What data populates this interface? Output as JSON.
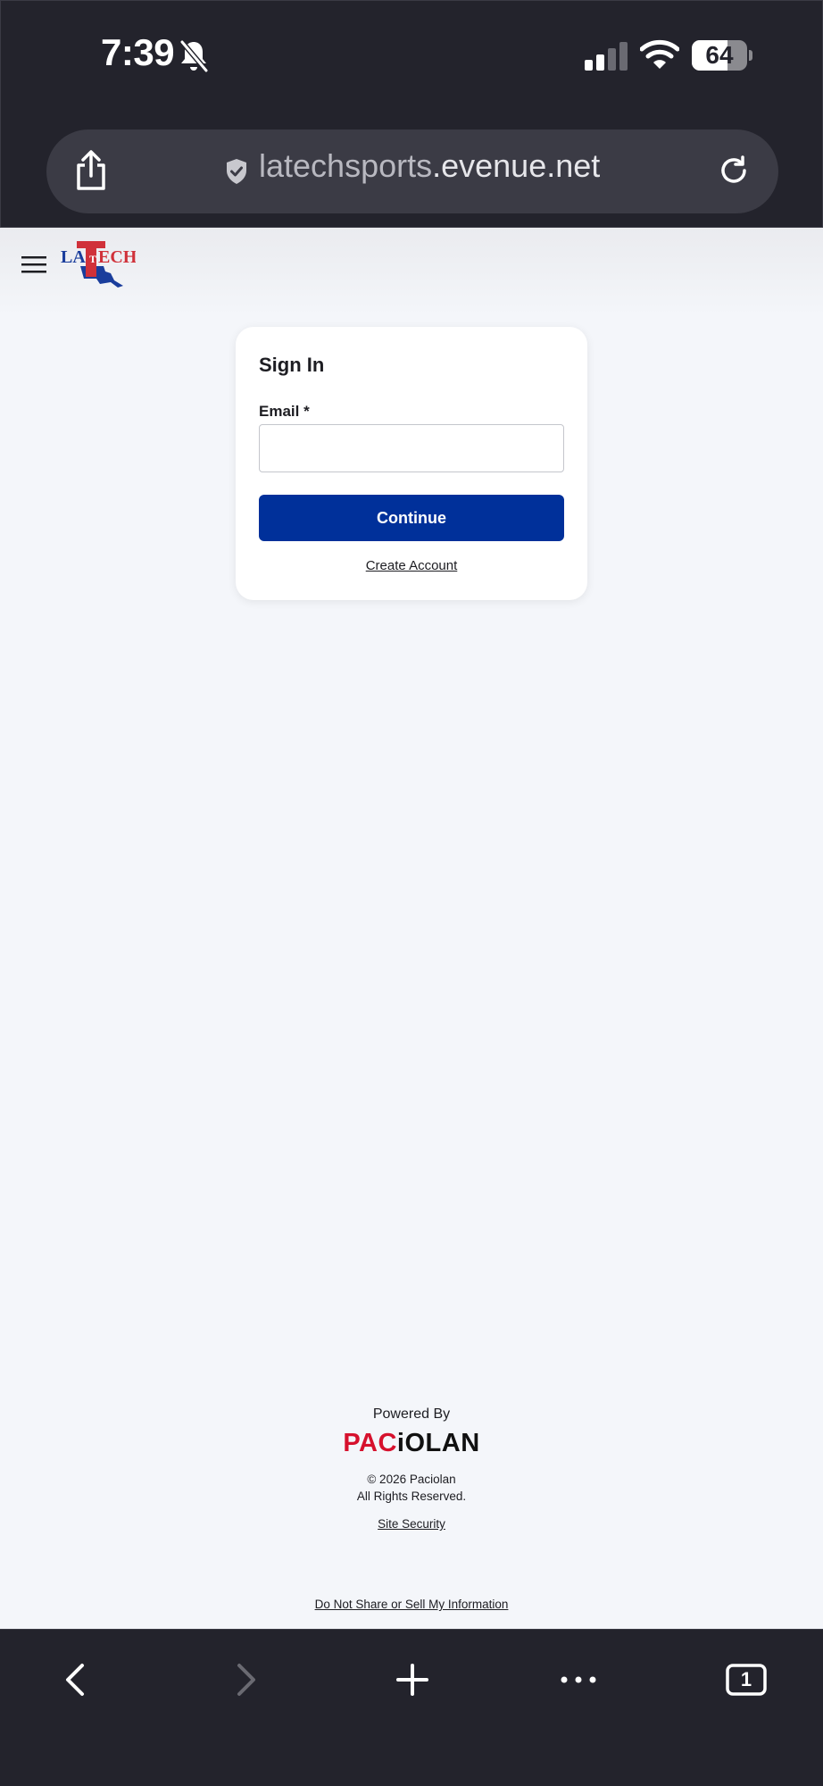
{
  "status_bar": {
    "time": "7:39",
    "battery_level": "64",
    "battery_fraction": 0.64,
    "icons": [
      "bell-slash-icon",
      "cellular-signal-icon",
      "wifi-icon",
      "battery-icon"
    ]
  },
  "address_bar": {
    "url_main": "latechsports",
    "url_domain": ".evenue.net",
    "icons": [
      "share-icon",
      "shield-check-icon",
      "reload-icon"
    ]
  },
  "header": {
    "logo_text_left": "LA",
    "logo_text_center": "T",
    "logo_text_right": "ECH",
    "icons": [
      "hamburger-menu-icon"
    ]
  },
  "sign_in": {
    "title": "Sign In",
    "email_label": "Email *",
    "email_value": "",
    "continue_label": "Continue",
    "create_account_label": "Create Account"
  },
  "footer": {
    "powered_by": "Powered By",
    "brand_red": "PAC",
    "brand_black": "iOLAN",
    "copyright_line1": "© 2026 Paciolan",
    "copyright_line2": "All Rights Reserved.",
    "site_security": "Site Security",
    "do_not_sell": "Do Not Share or Sell My Information"
  },
  "bottom_toolbar": {
    "tab_count": "1",
    "icons": [
      "back-icon",
      "forward-icon",
      "new-tab-icon",
      "more-icon",
      "tabs-icon"
    ]
  },
  "colors": {
    "browser_chrome": "#23232c",
    "address_bar": "#3b3b45",
    "page_background": "#f4f6fa",
    "primary_button": "#00309a",
    "paciolan_red": "#d6112d",
    "latech_red": "#d0313a",
    "latech_blue": "#1a3d9c"
  }
}
